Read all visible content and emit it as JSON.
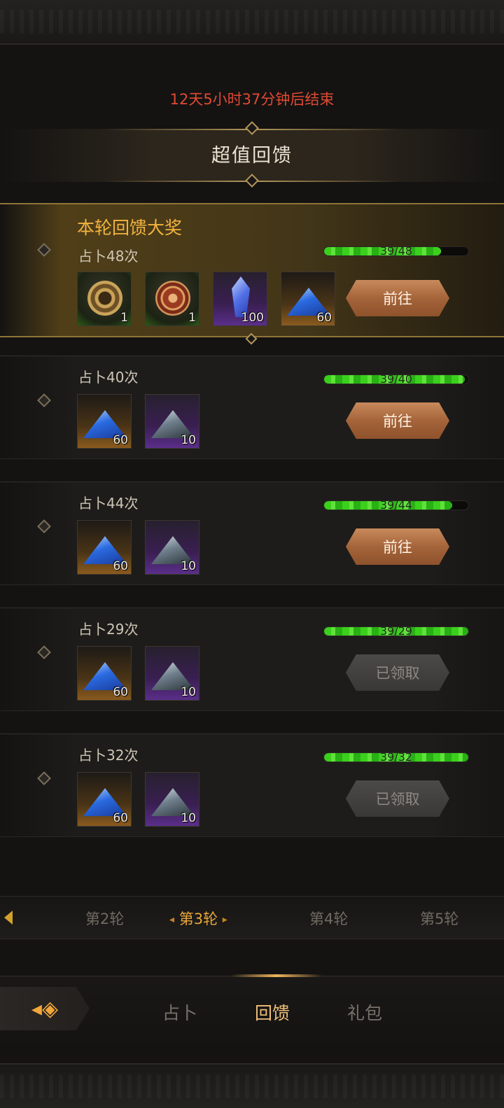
{
  "header": {
    "countdown": "12天5小时37分钟后结束",
    "title": "超值回馈"
  },
  "featured": {
    "title": "本轮回馈大奖",
    "task": "占卜48次",
    "progress": {
      "current": 39,
      "total": 48,
      "label": "39/48"
    },
    "items": [
      {
        "icon": "gold-compass-coin-icon",
        "rarity": "green",
        "qty": "1"
      },
      {
        "icon": "red-rune-coin-icon",
        "rarity": "green",
        "qty": "1"
      },
      {
        "icon": "blue-crystal-icon",
        "rarity": "purple",
        "qty": "100"
      },
      {
        "icon": "blue-ore-pile-icon",
        "rarity": "orange",
        "qty": "60"
      }
    ],
    "button": "前往"
  },
  "rewards": [
    {
      "task": "占卜40次",
      "progress": {
        "current": 39,
        "total": 40,
        "label": "39/40"
      },
      "items": [
        {
          "icon": "blue-ore-pile-icon",
          "rarity": "orange",
          "qty": "60"
        },
        {
          "icon": "grey-ore-pile-icon",
          "rarity": "purple",
          "qty": "10"
        }
      ],
      "button": "前往",
      "state": "go"
    },
    {
      "task": "占卜44次",
      "progress": {
        "current": 39,
        "total": 44,
        "label": "39/44"
      },
      "items": [
        {
          "icon": "blue-ore-pile-icon",
          "rarity": "orange",
          "qty": "60"
        },
        {
          "icon": "grey-ore-pile-icon",
          "rarity": "purple",
          "qty": "10"
        }
      ],
      "button": "前往",
      "state": "go"
    },
    {
      "task": "占卜29次",
      "progress": {
        "current": 29,
        "total": 29,
        "label": "39/29"
      },
      "items": [
        {
          "icon": "blue-ore-pile-icon",
          "rarity": "orange",
          "qty": "60"
        },
        {
          "icon": "grey-ore-pile-icon",
          "rarity": "purple",
          "qty": "10"
        }
      ],
      "button": "已领取",
      "state": "claimed"
    },
    {
      "task": "占卜32次",
      "progress": {
        "current": 32,
        "total": 32,
        "label": "39/32"
      },
      "items": [
        {
          "icon": "blue-ore-pile-icon",
          "rarity": "orange",
          "qty": "60"
        },
        {
          "icon": "grey-ore-pile-icon",
          "rarity": "purple",
          "qty": "10"
        }
      ],
      "button": "已领取",
      "state": "claimed"
    }
  ],
  "rounds": {
    "prev_icon": "chevron-left-icon",
    "tabs": [
      "第2轮",
      "第3轮",
      "第4轮",
      "第5轮"
    ],
    "active": "第3轮"
  },
  "nav": {
    "back_icon": "back-arrow-icon",
    "tabs": [
      "占卜",
      "回馈",
      "礼包"
    ],
    "active": "回馈"
  },
  "colors": {
    "accent_gold": "#f3b33e",
    "countdown_red": "#e04a34",
    "progress_green": "#3ad01c",
    "button_copper": "#a5643a"
  }
}
